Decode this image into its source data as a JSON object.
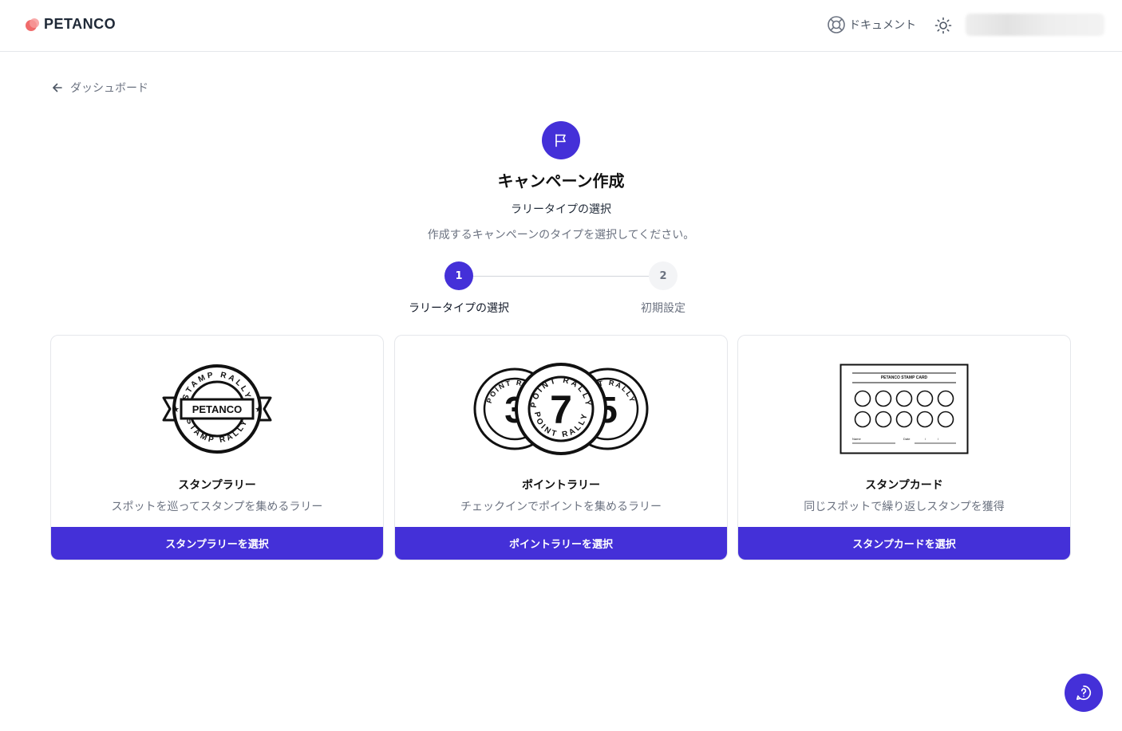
{
  "header": {
    "brand": "PETANCO",
    "docs_label": "ドキュメント"
  },
  "nav": {
    "back_label": "ダッシュボード"
  },
  "page": {
    "title": "キャンペーン作成",
    "subtitle": "ラリータイプの選択",
    "description": "作成するキャンペーンのタイプを選択してください。"
  },
  "stepper": {
    "active_step": 1,
    "steps": [
      {
        "number": "1",
        "label": "ラリータイプの選択"
      },
      {
        "number": "2",
        "label": "初期設定"
      }
    ]
  },
  "cards": [
    {
      "title": "スタンプラリー",
      "description": "スポットを巡ってスタンプを集めるラリー",
      "button": "スタンプラリーを選択",
      "illustration": {
        "badge_ring_text": "STAMP RALLY",
        "badge_center": "PETANCO"
      }
    },
    {
      "title": "ポイントラリー",
      "description": "チェックインでポイントを集めるラリー",
      "button": "ポイントラリーを選択",
      "illustration": {
        "coin_ring_text": "POINT RALLY",
        "coin_numbers": [
          "3",
          "7",
          "5"
        ]
      }
    },
    {
      "title": "スタンプカード",
      "description": "同じスポットで繰り返しスタンプを獲得",
      "button": "スタンプカードを選択",
      "illustration": {
        "card_heading": "PETANCO STAMP CARD",
        "name_label": "Name",
        "date_label": "Date",
        "date_separator": "/"
      }
    }
  ],
  "colors": {
    "primary": "#4430d8",
    "brand_logo": "#f06b6b",
    "border": "#e5e7eb",
    "muted_text": "#6b7280"
  },
  "icons": {
    "logo": "petanco-logo-icon",
    "docs": "lifebuoy-icon",
    "theme": "sun-icon",
    "back": "arrow-left-icon",
    "title": "flag-icon",
    "help": "help-circle-icon"
  }
}
